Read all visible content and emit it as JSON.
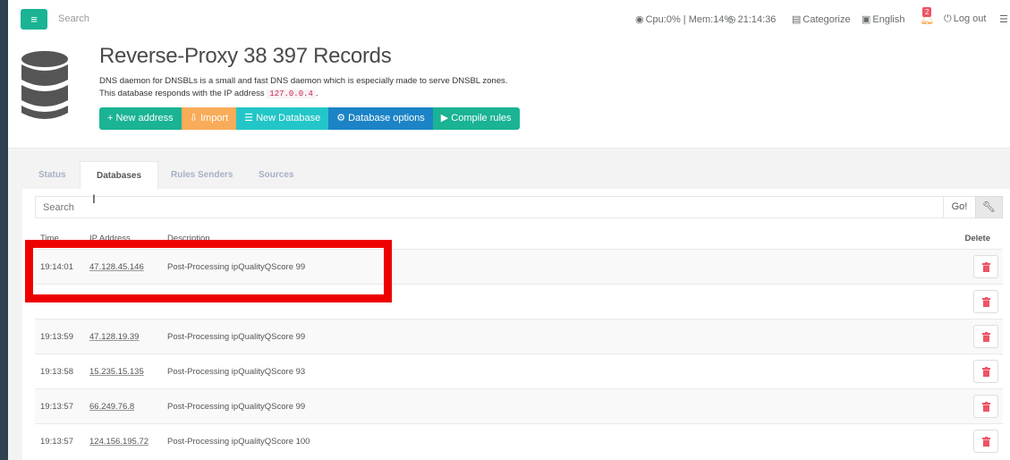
{
  "topnav": {
    "menu_glyph": "≡",
    "search_placeholder": "Search",
    "cpu_mem": "Cpu:0% | Mem:14%",
    "clock": "21:14:36",
    "categorize": "Categorize",
    "language": "English",
    "notif_count": "2",
    "logout": "Log out"
  },
  "header": {
    "title": "Reverse-Proxy 38 397 Records",
    "desc_line1": "DNS daemon for DNSBLs is a small and fast DNS daemon which is especially made to serve DNSBL zones.",
    "desc_line2_prefix": "This database responds with the IP address",
    "desc_ip": "127.0.0.4",
    "desc_line2_suffix": ".",
    "buttons": {
      "new_address": "+ New address",
      "import": "Import",
      "new_database": "New Database",
      "database_options": "Database options",
      "compile_rules": "▶ Compile rules"
    }
  },
  "tabs": [
    "Status",
    "Databases",
    "Rules Senders",
    "Sources"
  ],
  "search": {
    "placeholder": "Search",
    "go_label": "Go!"
  },
  "table": {
    "columns": [
      "Time",
      "IP Address",
      "Description",
      "Delete"
    ],
    "rows": [
      {
        "time": "19:14:01",
        "ip": "47.128.45.146",
        "desc": "Post-Processing ipQualityQScore 99"
      },
      {
        "time": "",
        "ip": "",
        "desc": ""
      },
      {
        "time": "19:13:59",
        "ip": "47.128.19.39",
        "desc": "Post-Processing ipQualityQScore 99"
      },
      {
        "time": "19:13:58",
        "ip": "15.235.15.135",
        "desc": "Post-Processing ipQualityQScore 93"
      },
      {
        "time": "19:13:57",
        "ip": "66.249.76.8",
        "desc": "Post-Processing ipQualityQScore 99"
      },
      {
        "time": "19:13:57",
        "ip": "124.156.195.72",
        "desc": "Post-Processing ipQualityQScore 100"
      }
    ]
  },
  "colors": {
    "primary": "#1ab394",
    "warning": "#f8ac59",
    "info": "#23c6c8",
    "success": "#1c84c6",
    "danger": "#ed5565",
    "highlight": "#ee0000"
  }
}
